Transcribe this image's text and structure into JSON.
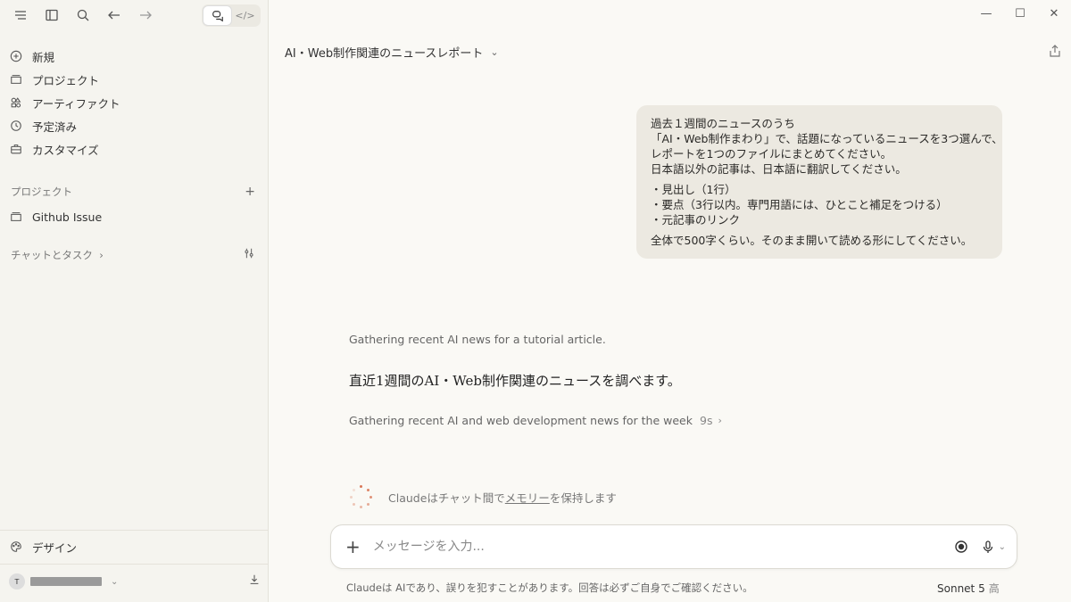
{
  "sidebar": {
    "nav": [
      {
        "label": "新規",
        "icon": "plus-icon"
      },
      {
        "label": "プロジェクト",
        "icon": "folder-icon"
      },
      {
        "label": "アーティファクト",
        "icon": "artifacts-icon"
      },
      {
        "label": "予定済み",
        "icon": "clock-icon"
      },
      {
        "label": "カスタマイズ",
        "icon": "briefcase-icon"
      }
    ],
    "projects_header": "プロジェクト",
    "projects": [
      {
        "label": "Github Issue"
      }
    ],
    "chats_header": "チャットとタスク",
    "chats_header_chevron": "›",
    "design_label": "デザイン",
    "user_initial": "T"
  },
  "main": {
    "title": "AI・Web制作関連のニュースレポート",
    "user_message": {
      "lines_1": [
        "過去１週間のニュースのうち",
        "「AI・Web制作まわり」で、話題になっているニュースを3つ選んで、",
        "レポートを1つのファイルにまとめてください。",
        "日本語以外の記事は、日本語に翻訳してください。"
      ],
      "lines_2": [
        "・見出し（1行）",
        "・要点（3行以内。専門用語には、ひとこと補足をつける）",
        "・元記事のリンク"
      ],
      "lines_3": [
        "全体で500字くらい。そのまま開いて読める形にしてください。"
      ]
    },
    "thinking_1": "Gathering recent AI news for a tutorial article.",
    "reply": "直近1週間のAI・Web制作関連のニュースを調べます。",
    "thinking_2": "Gathering recent AI and web development news for the week",
    "thinking_2_duration": "9s",
    "memory_prefix": "Claudeはチャット間で",
    "memory_link": "メモリー",
    "memory_suffix": "を保持します"
  },
  "composer": {
    "placeholder": "メッセージを入力...",
    "disclaimer": "Claudeは AIであり、誤りを犯すことがあります。回答は必ずご自身でご確認ください。",
    "model": "Sonnet 5",
    "effort": "高"
  },
  "colors": {
    "sidebar_bg": "#f5f4ef",
    "main_bg": "#faf9f5",
    "bubble_bg": "#ece9e1",
    "accent": "#d97757"
  }
}
